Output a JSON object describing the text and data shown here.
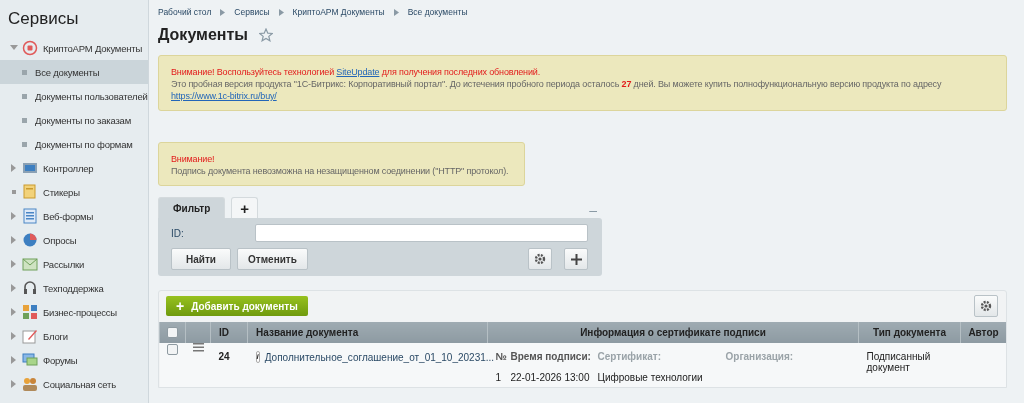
{
  "sidebar": {
    "title": "Сервисы",
    "items": [
      {
        "label": "КриптоАРМ Документы",
        "kind": "folder",
        "expanded": true,
        "selected": false,
        "children": [
          {
            "label": "Все документы",
            "selected": true
          },
          {
            "label": "Документы пользователей",
            "selected": false
          },
          {
            "label": "Документы по заказам",
            "selected": false
          },
          {
            "label": "Документы по формам",
            "selected": false
          }
        ]
      },
      {
        "label": "Контроллер",
        "kind": "folder",
        "expanded": false,
        "selected": false
      },
      {
        "label": "Стикеры",
        "kind": "leaf",
        "selected": false
      },
      {
        "label": "Веб-формы",
        "kind": "folder",
        "expanded": false,
        "selected": false
      },
      {
        "label": "Опросы",
        "kind": "folder",
        "expanded": false,
        "selected": false
      },
      {
        "label": "Рассылки",
        "kind": "folder",
        "expanded": false,
        "selected": false
      },
      {
        "label": "Техподдержка",
        "kind": "folder",
        "expanded": false,
        "selected": false
      },
      {
        "label": "Бизнес-процессы",
        "kind": "folder",
        "expanded": false,
        "selected": false
      },
      {
        "label": "Блоги",
        "kind": "folder",
        "expanded": false,
        "selected": false
      },
      {
        "label": "Форумы",
        "kind": "folder",
        "expanded": false,
        "selected": false
      },
      {
        "label": "Социальная сеть",
        "kind": "folder",
        "expanded": false,
        "selected": false
      }
    ]
  },
  "breadcrumbs": [
    "Рабочий стол",
    "Сервисы",
    "КриптоАРМ Документы",
    "Все документы"
  ],
  "page_title": "Документы",
  "notices": [
    {
      "warning": [
        {
          "kind": "text",
          "text": "Внимание! Воспользуйтесь технологией "
        },
        {
          "kind": "link",
          "text": "SiteUpdate"
        },
        {
          "kind": "text",
          "text": " для получения последних обновлений."
        }
      ],
      "text": [
        {
          "kind": "text",
          "text": "Это пробная версия продукта \"1С-Битрикс: Корпоративный портал\". До истечения пробного периода осталось "
        },
        {
          "kind": "bold",
          "text": "27"
        },
        {
          "kind": "text",
          "text": " дней. Вы можете купить полнофункциональную версию продукта по адресу "
        },
        {
          "kind": "link",
          "text": "https://www.1c-bitrix.ru/buy/"
        }
      ]
    },
    {
      "warning": [
        {
          "kind": "text",
          "text": "Внимание!"
        }
      ],
      "text": [
        {
          "kind": "text",
          "text": "Подпись документа невозможна на незащищенном соединении (\"HTTP\" протокол)."
        }
      ]
    }
  ],
  "filter": {
    "tabs": [
      {
        "label": "Фильтр",
        "selected": true
      },
      {
        "label": "+",
        "selected": false
      }
    ],
    "minimize": "–",
    "field_label": "ID:",
    "buttons": [
      "Найти",
      "Отменить"
    ]
  },
  "grid": {
    "add_button": "Добавить документы",
    "add_icon": "+",
    "columns": [
      "ID",
      "Название документа",
      "Информация о сертификате подписи",
      "Тип документа",
      "Автор"
    ],
    "header_checked": false,
    "rows": [
      {
        "checked": false,
        "id": "24",
        "info_icon": "i",
        "name": "Дополнительное_соглашение_от_01_10_20231...",
        "signature": {
          "headers": [
            "№",
            "Время подписи:",
            "Сертификат:",
            "Организация:"
          ],
          "values": [
            "1",
            "22-01-2026 13:00",
            "Цифровые технологии"
          ]
        },
        "type": "Подписанный документ"
      }
    ]
  }
}
